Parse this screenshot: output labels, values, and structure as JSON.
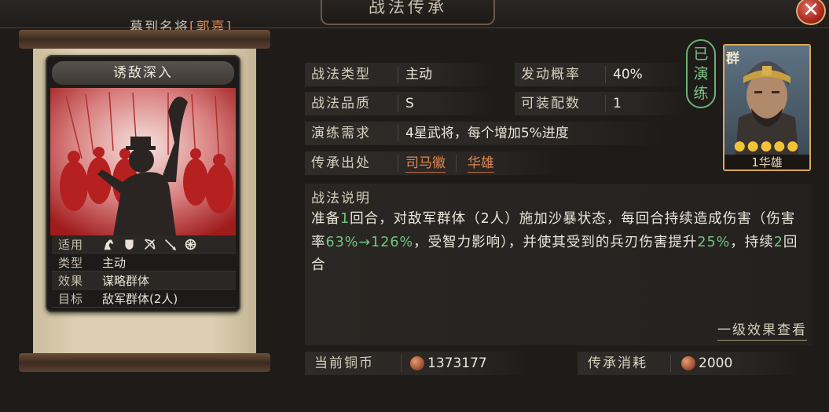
{
  "header": {
    "title": "战法传承",
    "recruit_prefix": "募到名将",
    "recruit_bracket_open": "[",
    "recruit_general": "郭嘉",
    "recruit_bracket_close": "]",
    "close_glyph": "✕"
  },
  "skill_card": {
    "name": "诱敌深入",
    "rows": [
      {
        "key": "适用",
        "icons": [
          "horse-icon",
          "shield-icon",
          "bow-icon",
          "spear-icon",
          "wheel-icon"
        ]
      },
      {
        "key": "类型",
        "value": "主动"
      },
      {
        "key": "效果",
        "value": "谋略群体"
      },
      {
        "key": "目标",
        "value": "敌军群体(2人)"
      }
    ]
  },
  "fields": {
    "type_key": "战法类型",
    "type_val": "主动",
    "prob_key": "发动概率",
    "prob_val": "40%",
    "quality_key": "战法品质",
    "quality_val": "S",
    "equip_key": "可装配数",
    "equip_val": "1",
    "req_key": "演练需求",
    "req_val": "4星武将，每个增加5%进度",
    "source_key": "传承出处",
    "source_gen1": "司马徽",
    "source_gen2": "华雄"
  },
  "badge": {
    "chars": [
      "已",
      "演",
      "练"
    ]
  },
  "portrait": {
    "faction": "群",
    "stars": "●●●●●",
    "name": "1华雄"
  },
  "description": {
    "title": "战法说明",
    "seg1": "准备",
    "seg2": "1",
    "seg3": "回合，对敌军群体（2人）施加沙暴状态，每回合持续造成伤害（伤害率",
    "seg4": "63%→126%",
    "seg5": "，受智力影响），并使其受到的兵刃伤害提升",
    "seg6": "25%",
    "seg7": "，持续",
    "seg8": "2",
    "seg9": "回合",
    "level1_link": "一级效果查看"
  },
  "footer": {
    "copper_label": "当前铜币",
    "copper_value": "1373177",
    "cost_label": "传承消耗",
    "cost_value": "2000"
  },
  "colors": {
    "accent_orange": "#e08850",
    "accent_green": "#6fc77e",
    "gold": "#d9a954"
  }
}
